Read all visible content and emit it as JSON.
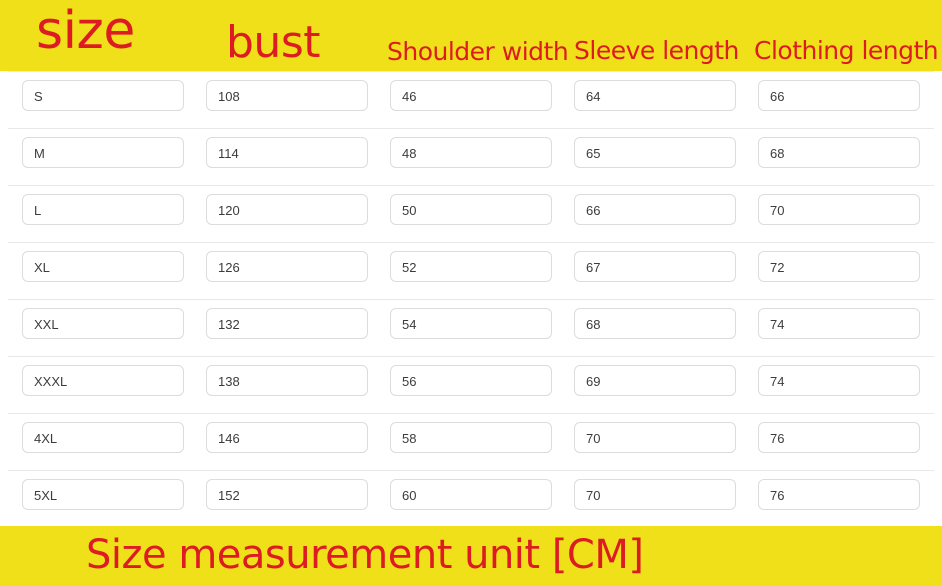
{
  "colors": {
    "banner_background": "#efe019",
    "banner_text": "#dd1b23",
    "cell_border": "#dcdcdc",
    "cell_text": "#3c3c3c",
    "row_separator": "#e8e8e8",
    "page_background": "#ffffff"
  },
  "header": {
    "columns": [
      {
        "label": "size"
      },
      {
        "label": "bust"
      },
      {
        "label": "Shoulder width"
      },
      {
        "label": "Sleeve length"
      },
      {
        "label": "Clothing length"
      }
    ]
  },
  "chart_data": {
    "type": "table",
    "title": "Size measurement unit [CM]",
    "columns": [
      "size",
      "bust",
      "Shoulder width",
      "Sleeve length",
      "Clothing length"
    ],
    "unit": "CM",
    "rows": [
      [
        "S",
        "108",
        "46",
        "64",
        "66"
      ],
      [
        "M",
        "114",
        "48",
        "65",
        "68"
      ],
      [
        "L",
        "120",
        "50",
        "66",
        "70"
      ],
      [
        "XL",
        "126",
        "52",
        "67",
        "72"
      ],
      [
        "XXL",
        "132",
        "54",
        "68",
        "74"
      ],
      [
        "XXXL",
        "138",
        "56",
        "69",
        "74"
      ],
      [
        "4XL",
        "146",
        "58",
        "70",
        "76"
      ],
      [
        "5XL",
        "152",
        "60",
        "70",
        "76"
      ]
    ]
  },
  "footer": {
    "label": "Size measurement unit [CM]"
  }
}
